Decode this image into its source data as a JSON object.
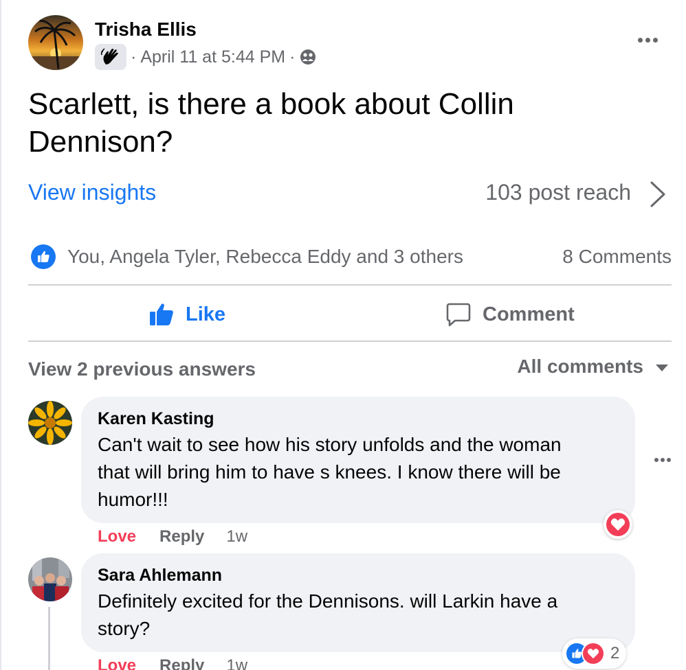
{
  "post": {
    "author": "Trisha Ellis",
    "timestamp": "April 11 at 5:44 PM",
    "separator": "·",
    "group_badge_icon": "waving-hand-icon",
    "privacy_icon": "group-members-icon",
    "text": "Scarlett, is there a book about Collin Dennison?",
    "insights_label": "View insights",
    "reach_label": "103 post reach",
    "reactions_summary": "You, Angela Tyler, Rebecca Eddy and 3 others",
    "comment_count_label": "8 Comments"
  },
  "actions": {
    "like_label": "Like",
    "comment_label": "Comment"
  },
  "comments_section": {
    "view_previous_label": "View 2 previous answers",
    "sort_label": "All comments"
  },
  "comments": [
    {
      "author": "Karen Kasting",
      "text_lines": [
        "Can't wait to see how his story unfolds and the woman",
        "that will bring him to have s knees. I know there will be",
        "humor!!!"
      ],
      "reaction_label": "Love",
      "reply_label": "Reply",
      "time": "1w"
    },
    {
      "author": "Sara Ahlemann",
      "text_lines": [
        "Definitely excited for the Dennisons. will Larkin have a",
        "story?"
      ],
      "reaction_label": "Love",
      "reply_label": "Reply",
      "time": "1w",
      "reaction_count": "2"
    }
  ],
  "colors": {
    "accent": "#1877f2",
    "love": "#f33e58",
    "secondary_text": "#65676b",
    "bubble_bg": "#f0f2f5"
  }
}
